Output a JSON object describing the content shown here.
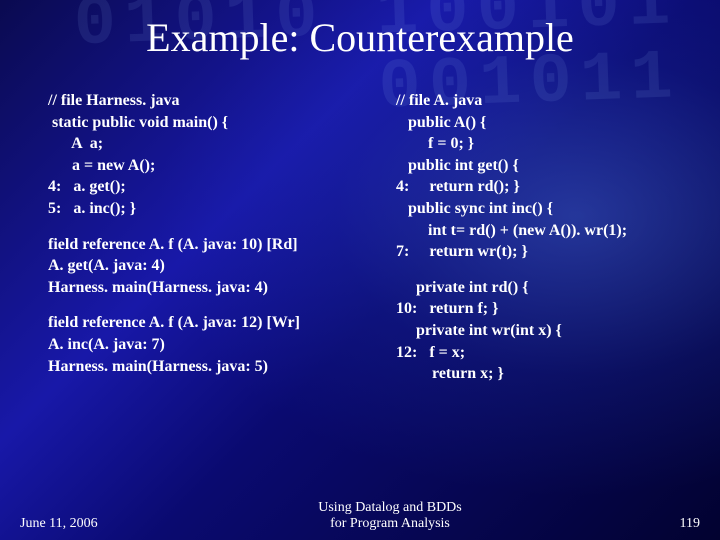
{
  "title": "Example: Counterexample",
  "left": {
    "header": "// file Harness. java",
    "l1": " static public void main() {",
    "l2": "      A  a;",
    "l3": "      a = new A();",
    "l4": "4:   a. get();",
    "l5": "5:   a. inc(); }",
    "refRd1": "field reference A. f (A. java: 10) [Rd]",
    "refRd2": "A. get(A. java: 4)",
    "refRd3": "Harness. main(Harness. java: 4)",
    "refWr1": "field reference A. f (A. java: 12) [Wr]",
    "refWr2": "A. inc(A. java: 7)",
    "refWr3": "Harness. main(Harness. java: 5)"
  },
  "right": {
    "header": "// file A. java",
    "l1": "   public A() {",
    "l2": "        f = 0; }",
    "l3": "   public int get() {",
    "l4": "4:     return rd(); }",
    "l5": "   public sync int inc() {",
    "l6": "        int t= rd() + (new A()). wr(1);",
    "l7": "7:     return wr(t); }",
    "l8": "     private int rd() {",
    "l9": "10:   return f; }",
    "l10": "     private int wr(int x) {",
    "l11": "12:   f = x;",
    "l12": "         return x; }"
  },
  "footer": {
    "date": "June 11, 2006",
    "center1": "Using Datalog and BDDs",
    "center2": "for Program Analysis",
    "page": "119"
  },
  "bg_digits": "01010\n100101\n001011"
}
